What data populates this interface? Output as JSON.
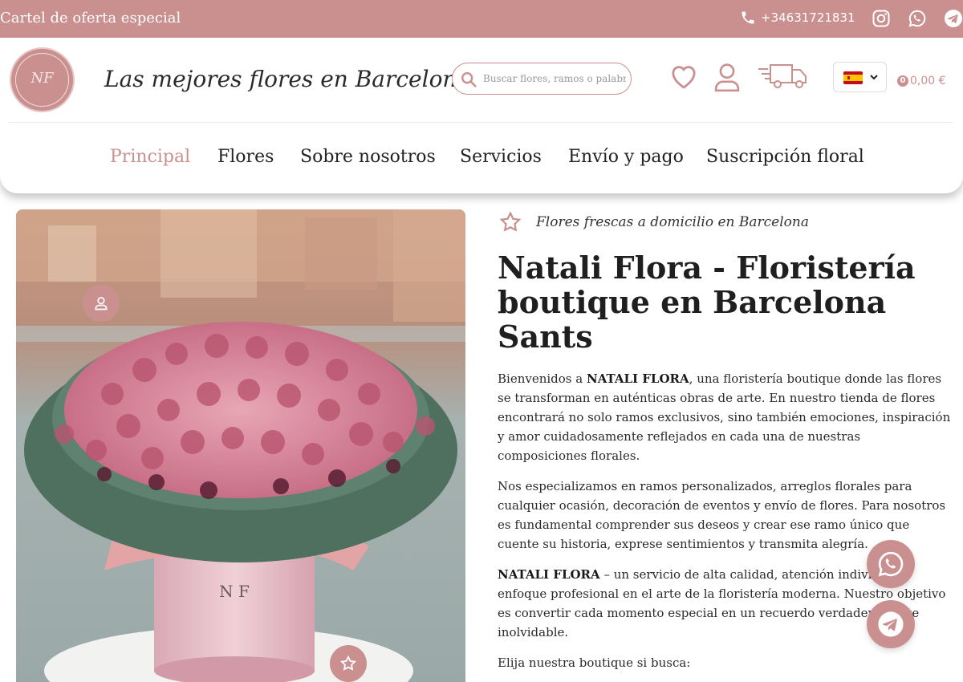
{
  "topbar": {
    "promo_text": "Cartel de oferta especial",
    "phone": "+34631721831",
    "icons": [
      "phone-icon",
      "instagram-icon",
      "whatsapp-icon",
      "telegram-icon"
    ]
  },
  "header": {
    "logo_text": "NF",
    "tagline": "Las mejores flores en Barcelona",
    "search_placeholder": "Buscar flores, ramos o palabras",
    "language": "ES",
    "cart_count": "0",
    "cart_total": "0,00 €"
  },
  "nav": {
    "items": [
      "Principal",
      "Flores",
      "Sobre nosotros",
      "Servicios",
      "Envío y pago",
      "Suscripción floral"
    ],
    "active": "Principal"
  },
  "content": {
    "eyebrow": "Flores frescas a domicilio en Barcelona",
    "title": "Natali Flora - Floristería boutique en Barcelona Sants",
    "p1_lead": "Bienvenidos a ",
    "p1_brand": "NATALI FLORA",
    "p1_rest": ", una floristería boutique donde las flores se transforman en auténticas obras de arte. En nuestro tienda de flores encontrará no solo ramos exclusivos, sino también emociones, inspiración y amor cuidadosamente reflejados en cada una de nuestras composiciones florales.",
    "p2": "Nos especializamos en ramos personalizados, arreglos florales para cualquier ocasión, decoración de eventos y envío de flores. Para nosotros es fundamental comprender sus deseos y crear ese ramo único que cuente su historia, exprese sentimientos y transmita alegría.",
    "p3_brand": "NATALI FLORA",
    "p3_rest": " – un servicio de alta calidad, atención individual y enfoque profesional en el arte de la floristería moderna. Nuestro objetivo es convertir cada momento especial en un recuerdo verdaderamente inolvidable.",
    "p4": "Elija nuestra boutique si busca:"
  },
  "hero": {
    "box_monogram": "N F"
  },
  "colors": {
    "accent": "#c9908f",
    "text": "#222222"
  }
}
